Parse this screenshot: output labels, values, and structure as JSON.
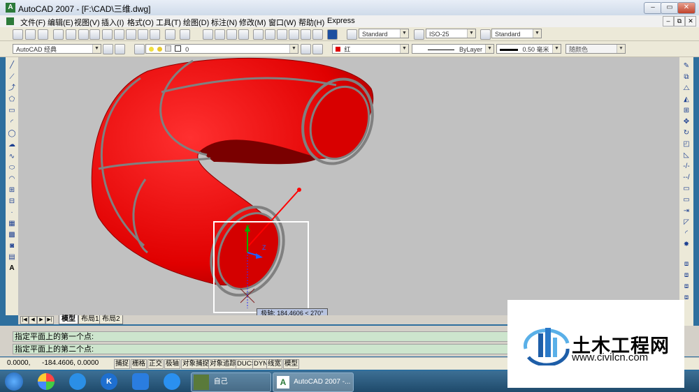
{
  "window": {
    "title": "AutoCAD 2007 - [F:\\CAD\\三维.dwg]",
    "icon": "autocad-app-icon"
  },
  "menu": [
    "文件(F)",
    "编辑(E)",
    "视图(V)",
    "插入(I)",
    "格式(O)",
    "工具(T)",
    "绘图(D)",
    "标注(N)",
    "修改(M)",
    "窗口(W)",
    "帮助(H)",
    "Express"
  ],
  "toolbar1": {
    "text_style": "Standard",
    "dim_style": "ISO-25",
    "table_style": "Standard"
  },
  "toolbar2": {
    "workspace": "AutoCAD 经典",
    "layer": "0",
    "color": "红",
    "linetype": "ByLayer",
    "lineweight": "0.50 毫米",
    "plotstyle": "随颜色"
  },
  "colors": {
    "layer_color": "#e00000",
    "torus": "#ee0000"
  },
  "tabs": {
    "model": "模型",
    "layout1": "布局1",
    "layout2": "布局2"
  },
  "command": {
    "line1": "指定平面上的第一个点:",
    "line2": "指定平面上的第二个点:"
  },
  "status": {
    "coords": "0.0000,      -184.4606, 0.0000",
    "buttons": [
      "捕捉",
      "栅格",
      "正交",
      "极轴",
      "对象捕捉",
      "对象追踪",
      "DUCS",
      "DYN",
      "线宽",
      "模型"
    ]
  },
  "tooltip": "极轴: 184.4606 < 270°",
  "ucs": {
    "y": "Y",
    "z": "Z"
  },
  "taskbar": {
    "task1": "自己",
    "task2": "AutoCAD 2007 -..."
  },
  "watermark": {
    "name": "土木工程网",
    "url": "www.civilcn.com"
  }
}
